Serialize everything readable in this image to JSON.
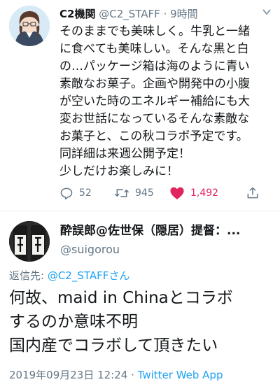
{
  "tweet1": {
    "display_name": "C2機関",
    "handle": "@C2_STAFF",
    "separator": "·",
    "time": "9時間",
    "body_lines": [
      "そのままでも美味しく。牛乳と一緒",
      "に食べても美味しい。そんな黒と白",
      "の…パッケージ箱は海のように青い",
      "素敵なお菓子。企画や開発中の小腹",
      "が空いた時のエネルギー補給にも大",
      "変お世話になっているそんな素敵な",
      "お菓子と、この秋コラボ予定です。",
      "同詳細は来週公開予定！",
      "少しだけお楽しみに！"
    ],
    "actions": {
      "reply_count": "52",
      "retweet_count": "945",
      "like_count": "1,492"
    }
  },
  "tweet2": {
    "display_name": "酔誤郎@佐世保（隠居）提督：...",
    "handle": "@suigorou",
    "reply_prefix": "返信先: ",
    "reply_to": "@C2_STAFFさん",
    "body_lines": [
      "何故、maid in Chinaとコラボ",
      "するのか意味不明",
      "国内産でコラボして頂きたい"
    ],
    "timestamp": "2019年09月23日 12:24",
    "separator": " · ",
    "source": "Twitter Web App"
  },
  "colors": {
    "text": "#14171a",
    "muted": "#657786",
    "link": "#1da1f2",
    "like": "#e0245e"
  }
}
